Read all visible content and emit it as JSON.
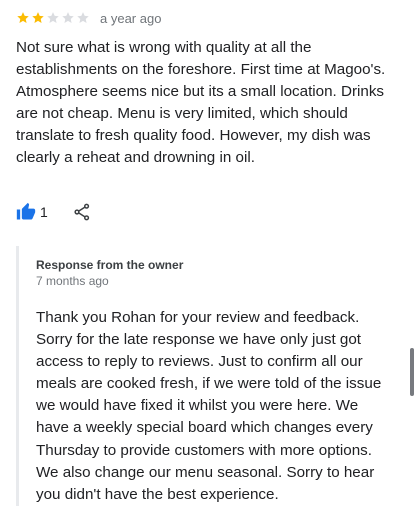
{
  "review": {
    "rating": 2,
    "max_rating": 5,
    "star_filled_color": "#fbbc04",
    "star_empty_color": "#dadce0",
    "time_ago": "a year ago",
    "text": "Not sure what is wrong with quality at all the establishments on the foreshore. First time at Magoo's. Atmosphere seems nice but its a small location. Drinks are not cheap. Menu is very limited, which should translate to fresh quality food. However, my dish was clearly a reheat and drowning in oil.",
    "like_icon": "thumbs-up-icon",
    "like_icon_color": "#1a73e8",
    "like_count": "1",
    "share_icon": "share-icon"
  },
  "owner_response": {
    "title": "Response from the owner",
    "time_ago": "7 months ago",
    "text": "Thank you Rohan for your review and feedback. Sorry for the late response we have only just got access to reply to reviews. Just to confirm all our meals are cooked fresh, if we were told of the issue we would have fixed it whilst you were here. We have a weekly special board which changes every Thursday to provide customers with more options. We also change our menu seasonal. Sorry to hear you didn't have the best experience."
  }
}
